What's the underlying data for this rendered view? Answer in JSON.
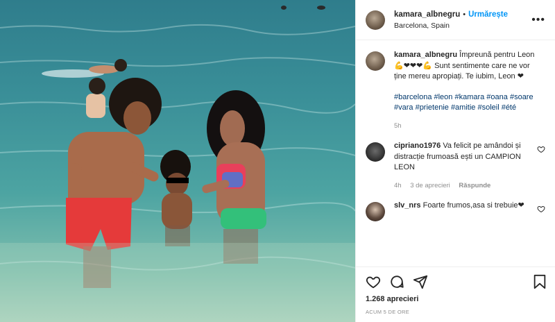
{
  "header": {
    "username": "kamara_albnegru",
    "separator": "•",
    "follow_label": "Urmărește",
    "location": "Barcelona, Spain",
    "more_label": "•••"
  },
  "caption": {
    "username": "kamara_albnegru",
    "text": "Împreună pentru Leon 💪❤❤❤💪 Sunt sentimente care ne vor ține mereu apropiați. Te iubim, Leon ❤",
    "tags": "#barcelona #leon #kamara #oana #soare #vara #prietenie #amitie #soleil #été",
    "time": "5h"
  },
  "comments": [
    {
      "username": "cipriano1976",
      "text": "Va felicit pe amândoi și distracție frumoasă ești un CAMPION LEON",
      "time": "4h",
      "date": "3 de aprecieri",
      "reply": "Răspunde"
    },
    {
      "username": "slv_nrs",
      "text": "Foarte frumos,asa si trebuie❤"
    }
  ],
  "footer": {
    "likes": "1.268 aprecieri",
    "timestamp": "ACUM 5 DE ORE"
  },
  "icons": [
    "heart-icon",
    "comment-icon",
    "share-icon",
    "bookmark-icon",
    "more-icon"
  ],
  "colors": {
    "accent": "#0095f6",
    "hashtag": "#00376b",
    "muted": "#8e8e8e"
  }
}
